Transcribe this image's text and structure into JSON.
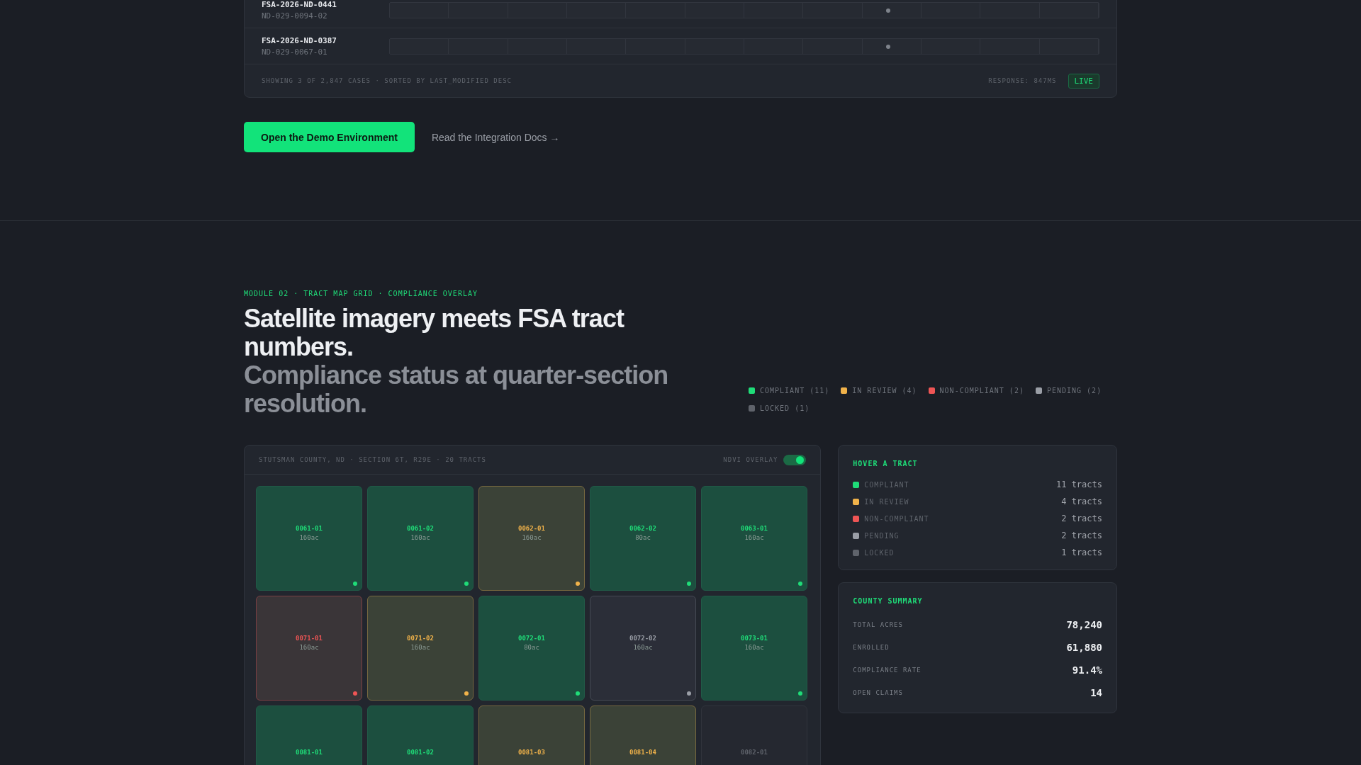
{
  "cases_table": {
    "rows": [
      {
        "case_id": "FSA-2026-ND-0441",
        "tract": "ND-029-0094-02",
        "level": 0.703
      },
      {
        "case_id": "FSA-2026-ND-0387",
        "tract": "ND-029-0067-01",
        "level": 0.703
      }
    ],
    "footer": "SHOWING 3 OF 2,847 CASES · SORTED BY LAST_MODIFIED DESC",
    "response": "RESPONSE: 847MS",
    "badge": "LIVE"
  },
  "actions": {
    "primary": "Open the Demo Environment",
    "link": "Read the Integration Docs →"
  },
  "module": {
    "eyebrow": "MODULE 02 · TRACT MAP GRID · COMPLIANCE OVERLAY",
    "title": "Satellite imagery meets FSA tract numbers.",
    "subtitle": "Compliance status at quarter-section resolution.",
    "legend": [
      {
        "label": "COMPLIANT",
        "count": "(11)",
        "color": "#1fdc78"
      },
      {
        "label": "IN REVIEW",
        "count": "(4)",
        "color": "#f0b24a"
      },
      {
        "label": "NON-COMPLIANT",
        "count": "(2)",
        "color": "#ee5555"
      },
      {
        "label": "PENDING",
        "count": "(2)",
        "color": "#9a9ea6"
      },
      {
        "label": "LOCKED",
        "count": "(1)",
        "color": "#5f636b"
      }
    ]
  },
  "map": {
    "caption": "STUTSMAN COUNTY, ND · SECTION 6T, R29E · 20 TRACTS",
    "overlay_label": "NDVI OVERLAY",
    "overlay_on": true,
    "tracts": [
      {
        "id": "0061-01",
        "acres": "160ac",
        "kind": "compliant"
      },
      {
        "id": "0061-02",
        "acres": "160ac",
        "kind": "compliant"
      },
      {
        "id": "0062-01",
        "acres": "160ac",
        "kind": "review"
      },
      {
        "id": "0062-02",
        "acres": "80ac",
        "kind": "compliant"
      },
      {
        "id": "0063-01",
        "acres": "160ac",
        "kind": "compliant"
      },
      {
        "id": "0071-01",
        "acres": "160ac",
        "kind": "noncompliant"
      },
      {
        "id": "0071-02",
        "acres": "160ac",
        "kind": "review"
      },
      {
        "id": "0072-01",
        "acres": "80ac",
        "kind": "compliant"
      },
      {
        "id": "0072-02",
        "acres": "160ac",
        "kind": "pending"
      },
      {
        "id": "0073-01",
        "acres": "160ac",
        "kind": "compliant"
      },
      {
        "id": "0081-01",
        "kind": "compliant"
      },
      {
        "id": "0081-02",
        "kind": "compliant"
      },
      {
        "id": "0081-03",
        "kind": "review"
      },
      {
        "id": "0081-04",
        "kind": "review"
      },
      {
        "id": "0082-01",
        "kind": "locked"
      }
    ]
  },
  "hover_panel": {
    "title": "HOVER A TRACT",
    "items": [
      {
        "label": "COMPLIANT",
        "value": "11 tracts",
        "color": "#1fdc78"
      },
      {
        "label": "IN REVIEW",
        "value": "4 tracts",
        "color": "#f0b24a"
      },
      {
        "label": "NON-COMPLIANT",
        "value": "2 tracts",
        "color": "#ee5555"
      },
      {
        "label": "PENDING",
        "value": "2 tracts",
        "color": "#9a9ea6"
      },
      {
        "label": "LOCKED",
        "value": "1 tracts",
        "color": "#5f636b"
      }
    ]
  },
  "county_summary": {
    "title": "COUNTY SUMMARY",
    "items": [
      {
        "label": "TOTAL ACRES",
        "value": "78,240"
      },
      {
        "label": "ENROLLED",
        "value": "61,880"
      },
      {
        "label": "COMPLIANCE RATE",
        "value": "91.4%"
      },
      {
        "label": "OPEN CLAIMS",
        "value": "14"
      }
    ]
  }
}
